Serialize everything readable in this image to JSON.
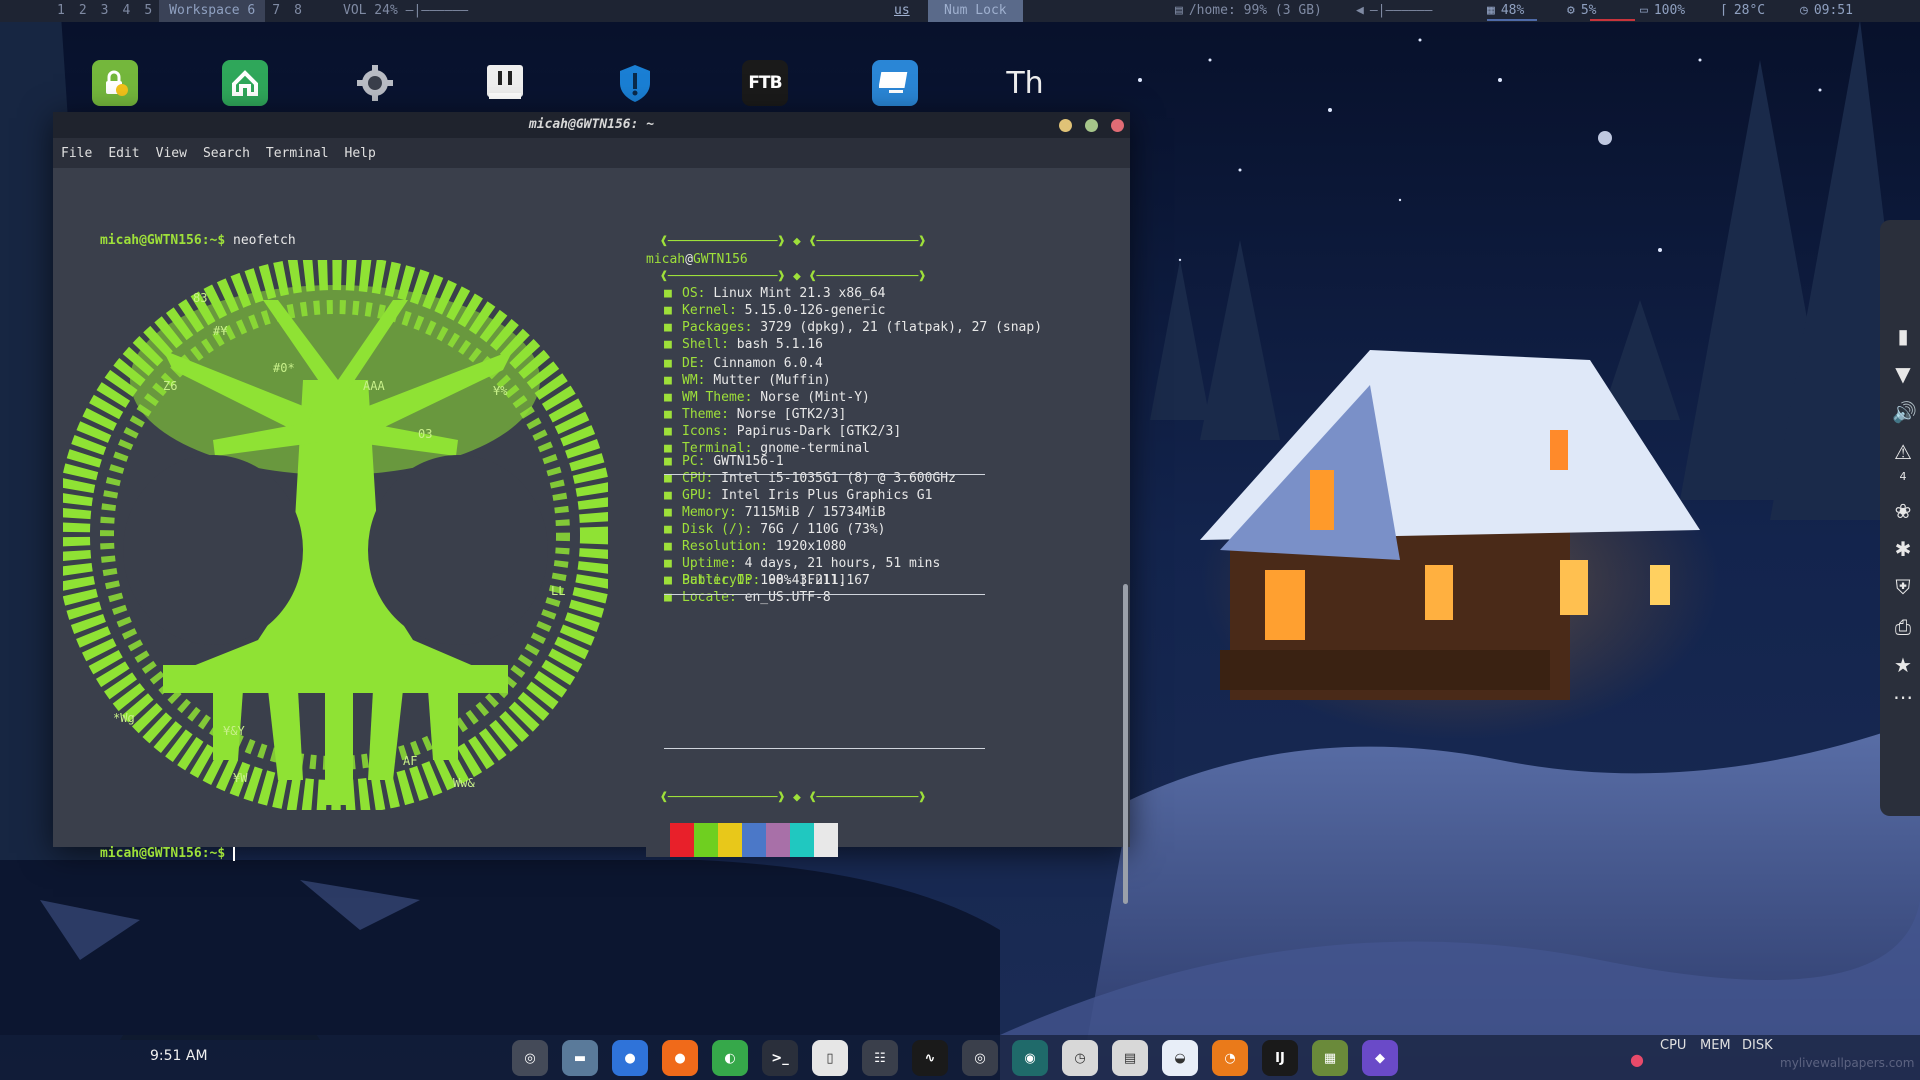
{
  "topbar": {
    "workspaces": [
      "1",
      "2",
      "3",
      "4",
      "5",
      "Workspace 6",
      "7",
      "8"
    ],
    "active_workspace": "Workspace 6",
    "volume": "VOL 24% —|——————",
    "keyboard_layout": "us",
    "num_lock": "Num Lock",
    "disk": "/home: 99% (3 GB)",
    "volume_slider": "—|——————",
    "memory": "48%",
    "cpu": "5%",
    "battery": "100%",
    "temperature": "28°C",
    "clock": "09:51"
  },
  "desktop_icons": [
    "lock-vpn-icon",
    "home-app-icon",
    "settings-gear-icon",
    "chat-app-icon",
    "shield-app-icon",
    "ftb-launcher-icon",
    "remote-desktop-icon",
    "font-app-icon"
  ],
  "desktop_icon_text": {
    "ftb": "FTB",
    "font": "Th"
  },
  "terminal": {
    "title": "micah@GWTN156: ~",
    "menu": [
      "File",
      "Edit",
      "View",
      "Search",
      "Terminal",
      "Help"
    ],
    "prompt": "micah@GWTN156:~$",
    "command": "neofetch",
    "frame_top": "❰──────────────❱ ◆ ❰─────────────❱",
    "user": "micah",
    "host": "GWTN156",
    "sections": [
      [
        {
          "key": "OS:",
          "value": "Linux Mint 21.3 x86_64"
        },
        {
          "key": "Kernel:",
          "value": "5.15.0-126-generic"
        },
        {
          "key": "Packages:",
          "value": "3729 (dpkg), 21 (flatpak), 27 (snap)"
        },
        {
          "key": "Shell:",
          "value": "bash 5.1.16"
        }
      ],
      [
        {
          "key": "DE:",
          "value": "Cinnamon 6.0.4"
        },
        {
          "key": "WM:",
          "value": "Mutter (Muffin)"
        },
        {
          "key": "WM Theme:",
          "value": "Norse (Mint-Y)"
        },
        {
          "key": "Theme:",
          "value": "Norse [GTK2/3]"
        },
        {
          "key": "Icons:",
          "value": "Papirus-Dark [GTK2/3]"
        },
        {
          "key": "Terminal:",
          "value": "gnome-terminal"
        }
      ],
      [
        {
          "key": "PC:",
          "value": "GWTN156-1"
        },
        {
          "key": "CPU:",
          "value": "Intel i5-1035G1 (8) @ 3.600GHz"
        },
        {
          "key": "GPU:",
          "value": "Intel Iris Plus Graphics G1"
        },
        {
          "key": "Memory:",
          "value": "7115MiB / 15734MiB"
        },
        {
          "key": "Disk (/):",
          "value": "76G / 110G (73%)"
        },
        {
          "key": "Resolution:",
          "value": "1920x1080"
        },
        {
          "key": "Uptime:",
          "value": "4 days, 21 hours, 51 mins"
        },
        {
          "key": "Battery0:",
          "value": "100% [Full]"
        }
      ],
      [
        {
          "key": "Public IP:",
          "value": "98.43.211.167"
        },
        {
          "key": "Locale:",
          "value": "en_US.UTF-8"
        }
      ]
    ],
    "palette": [
      "#3a3f4b",
      "#e8202a",
      "#6fcf20",
      "#e8c81a",
      "#4b78c8",
      "#a870a8",
      "#20c8c0",
      "#e8e8e8"
    ],
    "ascii_fragments": [
      "83",
      "#¥",
      "Z6",
      "¥%",
      "#0*",
      "03",
      "AAA",
      "*Wg",
      "¥&Y",
      "LL",
      "¥W",
      "AF",
      "Ww&"
    ]
  },
  "sidepanel_icons": [
    "battery-icon",
    "wifi-icon",
    "speaker-icon",
    "notification-icon",
    "color-picker-icon",
    "bluetooth-icon",
    "shield-icon",
    "printer-icon",
    "star-icon",
    "more-icon"
  ],
  "sidepanel_badge": "4",
  "bottom": {
    "clock": "9:51 AM",
    "dock": [
      "mint-menu-icon",
      "files-icon",
      "chromium-icon",
      "firefox-icon",
      "chrome-icon",
      "terminal-icon",
      "text-editor-icon",
      "calculator-icon",
      "system-monitor-icon",
      "obs-icon",
      "gitkraken-icon",
      "timeshift-icon",
      "gedit-icon",
      "vpn-globe-icon",
      "blender-icon",
      "intellij-icon",
      "minecraft-icon",
      "obsidian-icon"
    ],
    "dock_text": {
      "intellij": "IJ"
    },
    "sysmon": [
      "CPU",
      "MEM",
      "DISK"
    ],
    "watermark": "mylivewallpapers.com"
  }
}
